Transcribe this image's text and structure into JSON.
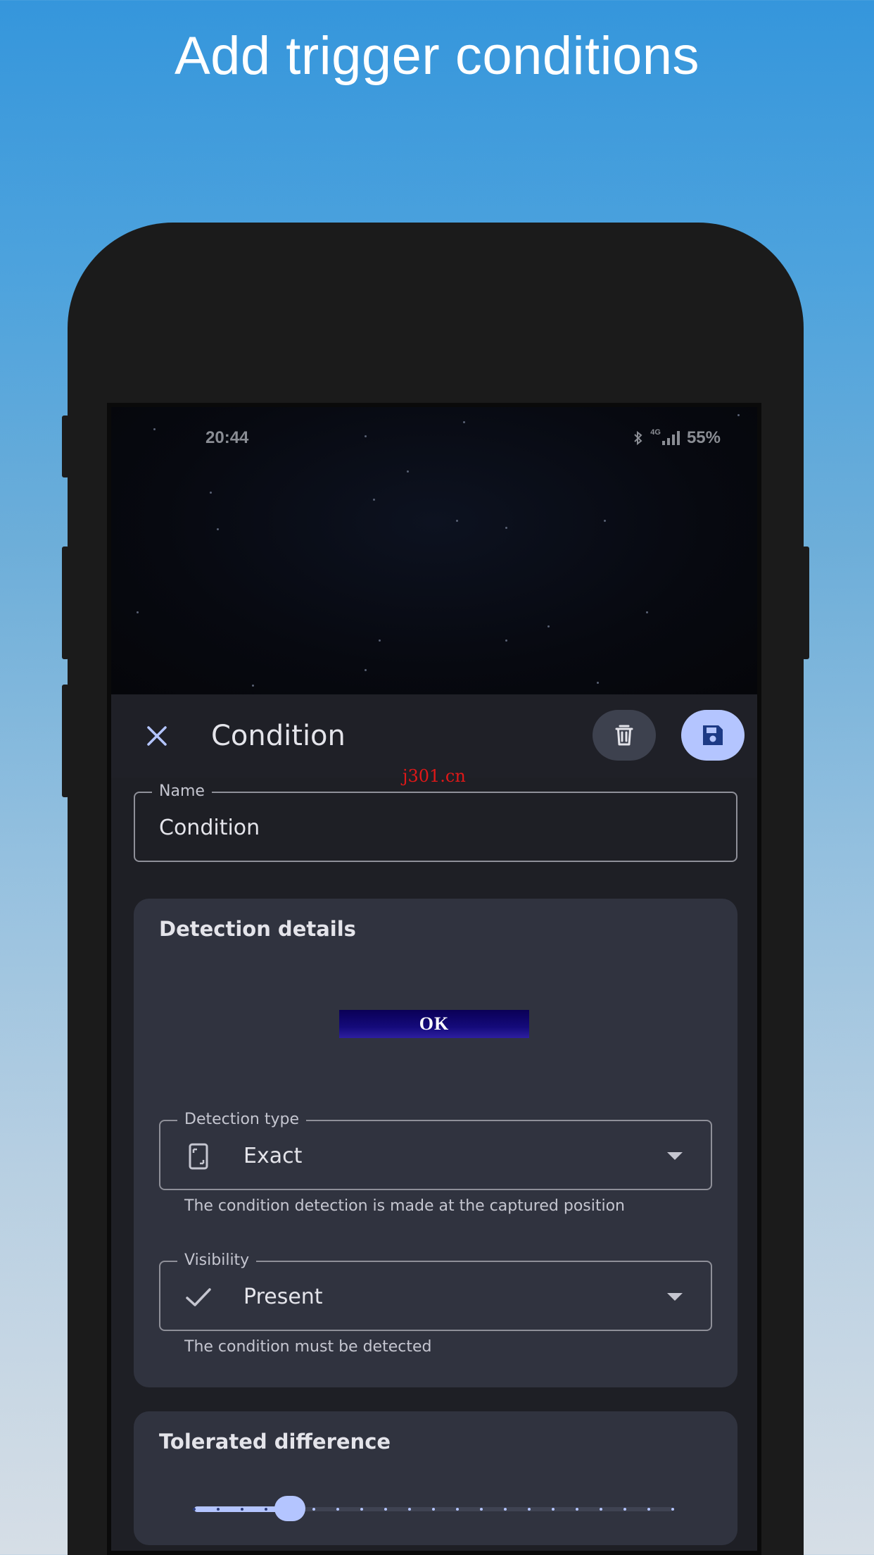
{
  "marketing": {
    "headline": "Add trigger conditions"
  },
  "status_bar": {
    "time": "20:44",
    "network": "4G",
    "battery": "55%"
  },
  "app_bar": {
    "title": "Condition",
    "close_icon": "close-icon",
    "delete_icon": "trash-icon",
    "save_icon": "floppy-disk-icon"
  },
  "name_field": {
    "label": "Name",
    "value": "Condition"
  },
  "detection_details": {
    "title": "Detection details",
    "preview_text": "OK",
    "detection_type": {
      "label": "Detection type",
      "value": "Exact",
      "icon": "screen-position-icon",
      "helper": "The condition detection is made at the captured position"
    },
    "visibility": {
      "label": "Visibility",
      "value": "Present",
      "icon": "checkmark-icon",
      "helper": "The condition must be detected"
    }
  },
  "tolerated_difference": {
    "title": "Tolerated difference",
    "slider": {
      "min": 0,
      "max": 20,
      "value": 4
    }
  },
  "watermark": "j301.cn",
  "colors": {
    "accent": "#b4c5ff",
    "sheet_bg": "#1e1f25",
    "card_bg": "#30333f",
    "preview_bg": "#140a7a"
  }
}
